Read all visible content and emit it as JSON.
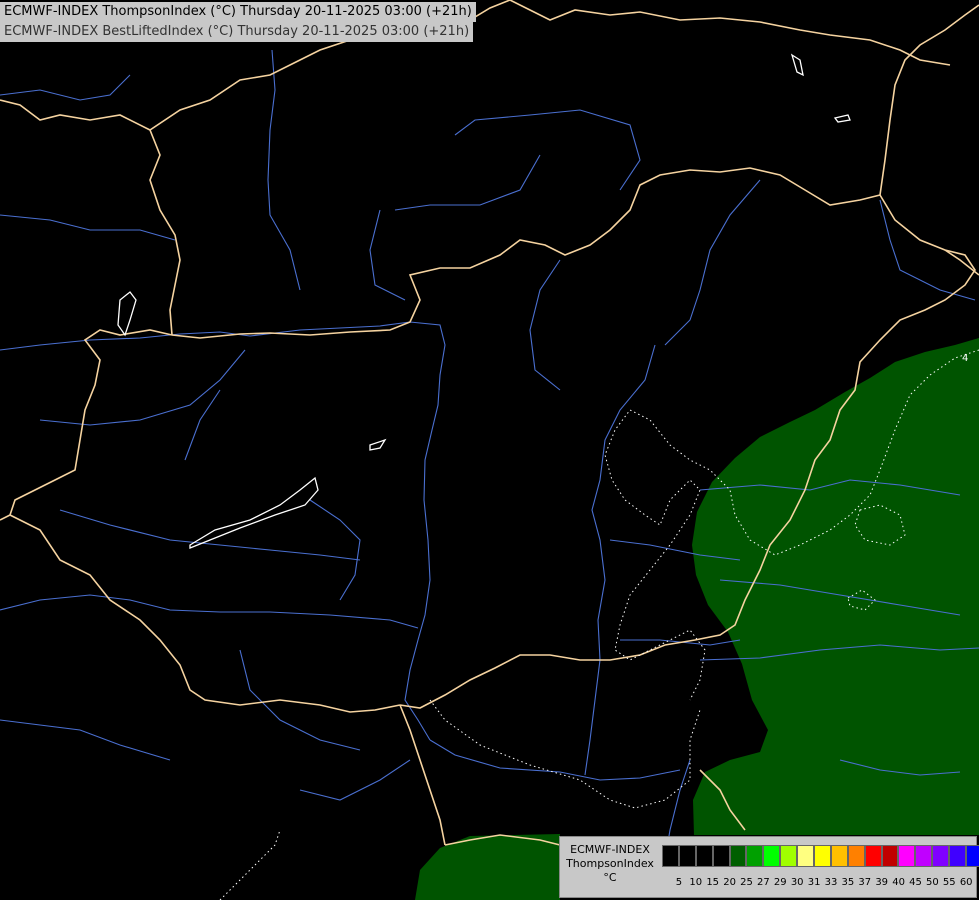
{
  "header": {
    "line1": "ECMWF-INDEX ThompsonIndex (°C) Thursday 20-11-2025 03:00 (+21h)",
    "line2": "ECMWF-INDEX BestLiftedIndex (°C) Thursday 20-11-2025 03:00 (+21h)"
  },
  "legend": {
    "model": "ECMWF-INDEX",
    "parameter": "ThompsonIndex",
    "unit": "°C",
    "ticks": [
      "5",
      "10",
      "15",
      "20",
      "25",
      "27",
      "29",
      "30",
      "31",
      "33",
      "35",
      "37",
      "39",
      "40",
      "45",
      "50",
      "55",
      "60"
    ],
    "colors": [
      "#000000",
      "#000000",
      "#000000",
      "#000000",
      "#005f00",
      "#00a000",
      "#00ff00",
      "#a0ff00",
      "#ffff80",
      "#ffff00",
      "#ffc000",
      "#ff8000",
      "#ff0000",
      "#c00000",
      "#ff00ff",
      "#c000ff",
      "#8000ff",
      "#4000ff",
      "#0000ff"
    ]
  },
  "map": {
    "contour_label": "4",
    "colors": {
      "background": "#000000",
      "border": "#f5d3a0",
      "river": "#4a6fd0",
      "lake_outline": "#ffffff",
      "ti_fill": "#005400",
      "li_contour": "#ffffff"
    }
  }
}
